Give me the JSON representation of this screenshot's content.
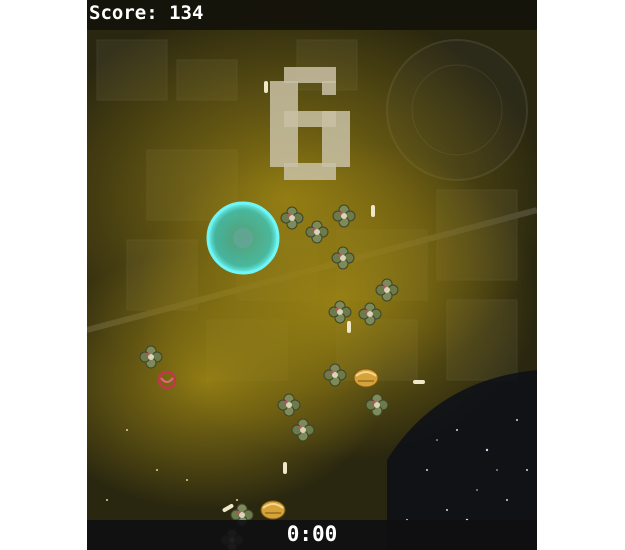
{
  "hud": {
    "score_label": "Score:",
    "score_value": "134",
    "timer": "0:00",
    "wave_number": "6"
  },
  "colors": {
    "fog": "#9a8212",
    "shield": "#3fe3e6",
    "hud_bg": "#15130a",
    "text": "#ffffff"
  },
  "entities": {
    "player": "player-shield-orb",
    "enemies": "green-pod-enemy",
    "elites": "gold-shell-enemy",
    "hazard": "red-spiral-enemy",
    "projectiles": "white-bullet"
  }
}
